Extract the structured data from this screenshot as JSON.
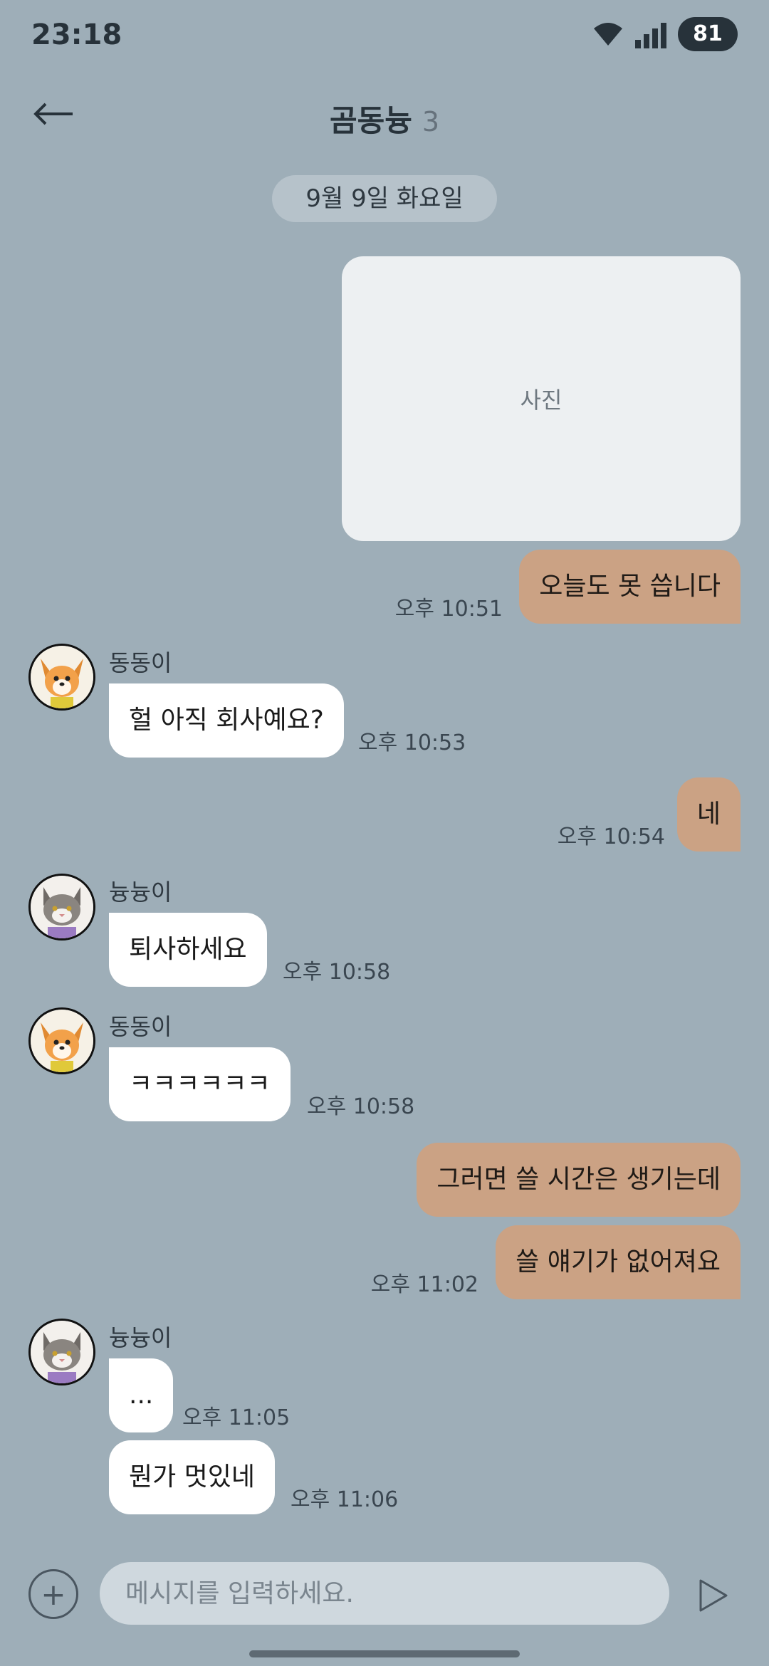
{
  "status": {
    "time": "23:18",
    "battery": "81"
  },
  "header": {
    "title": "곰동늉",
    "member_count": "3"
  },
  "date_divider": "9월 9일 화요일",
  "photo_label": "사진",
  "messages": [
    {
      "text": "오늘도 못 씁니다",
      "time": "오후 10:51"
    },
    {
      "sender": "동동이",
      "text": "헐 아직 회사예요?",
      "time": "오후 10:53"
    },
    {
      "text": "네",
      "time": "오후 10:54"
    },
    {
      "sender": "늉늉이",
      "text": "퇴사하세요",
      "time": "오후 10:58"
    },
    {
      "sender": "동동이",
      "text": "ㅋㅋㅋㅋㅋㅋ",
      "time": "오후 10:58"
    },
    {
      "text": "그러면 쓸 시간은 생기는데"
    },
    {
      "text": "쓸 얘기가 없어져요",
      "time": "오후 11:02"
    },
    {
      "sender": "늉늉이",
      "text": "...",
      "time": "오후 11:05"
    },
    {
      "text": "뭔가 멋있네",
      "time": "오후 11:06"
    }
  ],
  "composer": {
    "placeholder": "메시지를 입력하세요."
  },
  "colors": {
    "background": "#9eaeb8",
    "my_bubble": "#cba284",
    "other_bubble": "#ffffff"
  }
}
